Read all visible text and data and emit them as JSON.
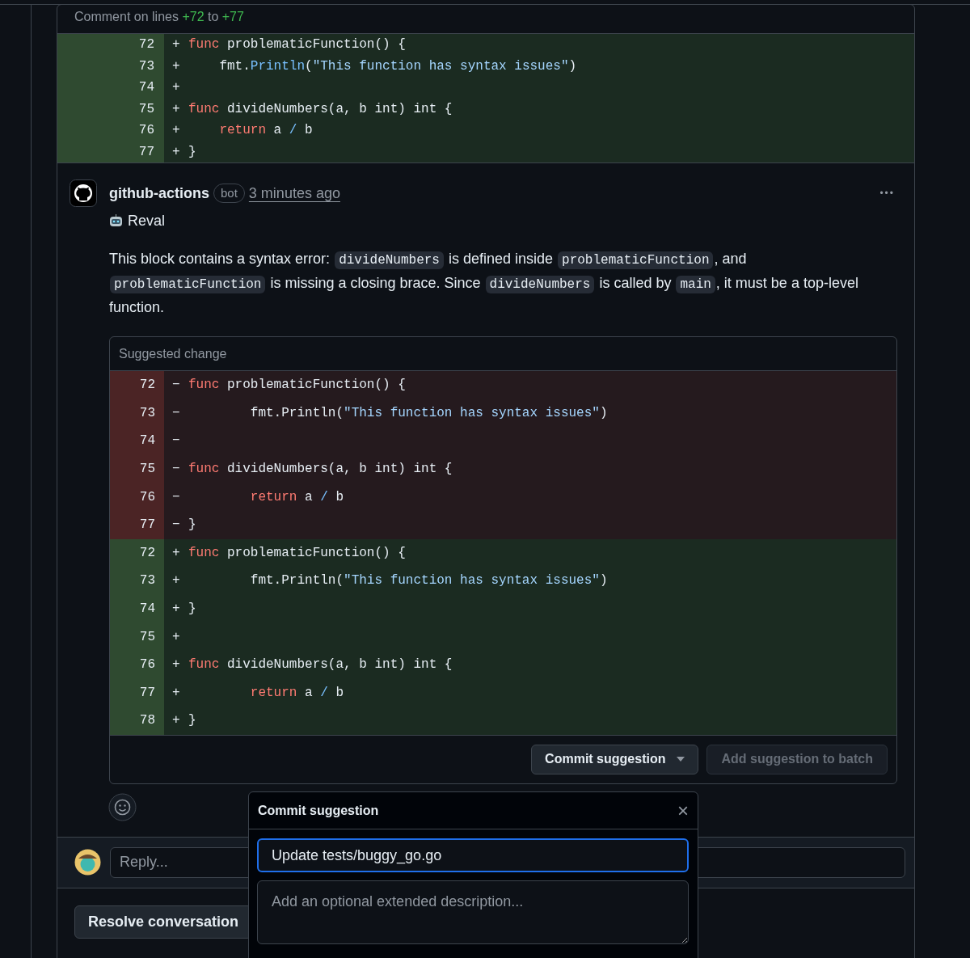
{
  "thread_header": {
    "prefix": "Comment on lines",
    "from": "+72",
    "middle": "to",
    "to": "+77"
  },
  "context_lines": [
    {
      "number": "72",
      "sign": "+",
      "tokens": [
        {
          "kind": "keyword",
          "text": "func"
        },
        {
          "kind": "plain",
          "text": " problematicFunction() {"
        }
      ]
    },
    {
      "number": "73",
      "sign": "+",
      "tokens": [
        {
          "kind": "plain",
          "text": "    fmt."
        },
        {
          "kind": "call",
          "text": "Println"
        },
        {
          "kind": "plain",
          "text": "("
        },
        {
          "kind": "string",
          "text": "\"This function has syntax issues\""
        },
        {
          "kind": "plain",
          "text": ")"
        }
      ]
    },
    {
      "number": "74",
      "sign": "+"
    },
    {
      "number": "75",
      "sign": "+",
      "tokens": [
        {
          "kind": "keyword",
          "text": "func"
        },
        {
          "kind": "plain",
          "text": " divideNumbers(a, b int) int {"
        }
      ]
    },
    {
      "number": "76",
      "sign": "+",
      "tokens": [
        {
          "kind": "keyword",
          "text": "    return"
        },
        {
          "kind": "plain",
          "text": " a "
        },
        {
          "kind": "call",
          "text": "/"
        },
        {
          "kind": "plain",
          "text": " b"
        }
      ]
    },
    {
      "number": "77",
      "sign": "+",
      "tokens": [
        {
          "kind": "plain",
          "text": "}"
        }
      ]
    }
  ],
  "comment": {
    "author": "github-actions",
    "badge": "bot",
    "time": "3 minutes ago",
    "more": "•••",
    "title": "Reval",
    "body": [
      {
        "kind": "text",
        "text": "This block contains a syntax error: "
      },
      {
        "kind": "code",
        "text": "divideNumbers"
      },
      {
        "kind": "text",
        "text": " is defined inside "
      },
      {
        "kind": "code",
        "text": "problematicFunction"
      },
      {
        "kind": "text",
        "text": ", and "
      },
      {
        "kind": "code",
        "text": "problematicFunction"
      },
      {
        "kind": "text",
        "text": " is missing a closing brace. Since "
      },
      {
        "kind": "code",
        "text": "divideNumbers"
      },
      {
        "kind": "text",
        "text": " is called by "
      },
      {
        "kind": "code",
        "text": "main"
      },
      {
        "kind": "text",
        "text": ", it must be a top-level function."
      }
    ]
  },
  "suggestion": {
    "title": "Suggested change",
    "lines": [
      {
        "kind": "removed",
        "number": "72",
        "sign": "−",
        "tokens": [
          {
            "kind": "keyword",
            "text": "func"
          },
          {
            "kind": "plain",
            "text": " problematicFunction() {"
          }
        ]
      },
      {
        "kind": "removed",
        "number": "73",
        "sign": "−",
        "tokens": [
          {
            "kind": "plain",
            "text": "        fmt.Println("
          },
          {
            "kind": "string",
            "text": "\"This function has syntax issues\""
          },
          {
            "kind": "plain",
            "text": ")"
          }
        ]
      },
      {
        "kind": "removed",
        "number": "74",
        "sign": "−"
      },
      {
        "kind": "removed",
        "number": "75",
        "sign": "−",
        "tokens": [
          {
            "kind": "keyword",
            "text": "func"
          },
          {
            "kind": "plain",
            "text": " divideNumbers(a, b int) int {"
          }
        ]
      },
      {
        "kind": "removed",
        "number": "76",
        "sign": "−",
        "tokens": [
          {
            "kind": "keyword",
            "text": "        return"
          },
          {
            "kind": "plain",
            "text": " a "
          },
          {
            "kind": "call",
            "text": "/"
          },
          {
            "kind": "plain",
            "text": " b"
          }
        ]
      },
      {
        "kind": "removed",
        "number": "77",
        "sign": "−",
        "tokens": [
          {
            "kind": "plain",
            "text": "}"
          }
        ]
      },
      {
        "kind": "added",
        "number": "72",
        "sign": "+",
        "tokens": [
          {
            "kind": "keyword",
            "text": "func"
          },
          {
            "kind": "plain",
            "text": " problematicFunction() {"
          }
        ]
      },
      {
        "kind": "added",
        "number": "73",
        "sign": "+",
        "tokens": [
          {
            "kind": "plain",
            "text": "        fmt.Println("
          },
          {
            "kind": "string",
            "text": "\"This function has syntax issues\""
          },
          {
            "kind": "plain",
            "text": ")"
          }
        ]
      },
      {
        "kind": "added",
        "number": "74",
        "sign": "+",
        "tokens": [
          {
            "kind": "plain",
            "text": "}"
          }
        ]
      },
      {
        "kind": "added",
        "number": "75",
        "sign": "+"
      },
      {
        "kind": "added",
        "number": "76",
        "sign": "+",
        "tokens": [
          {
            "kind": "keyword",
            "text": "func"
          },
          {
            "kind": "plain",
            "text": " divideNumbers(a, b int) int {"
          }
        ]
      },
      {
        "kind": "added",
        "number": "77",
        "sign": "+",
        "tokens": [
          {
            "kind": "keyword",
            "text": "        return"
          },
          {
            "kind": "plain",
            "text": " a "
          },
          {
            "kind": "call",
            "text": "/"
          },
          {
            "kind": "plain",
            "text": " b"
          }
        ]
      },
      {
        "kind": "added",
        "number": "78",
        "sign": "+",
        "tokens": [
          {
            "kind": "plain",
            "text": "}"
          }
        ]
      }
    ],
    "commit_button": "Commit suggestion",
    "batch_button": {
      "label": "Add suggestion to batch",
      "disabled": true
    }
  },
  "reply": {
    "placeholder": "Reply..."
  },
  "resolve_button": "Resolve conversation",
  "commit_dialog": {
    "title": "Commit suggestion",
    "close": "×",
    "message": "Update tests/buggy_go.go",
    "description_placeholder": "Add an optional extended description..."
  }
}
